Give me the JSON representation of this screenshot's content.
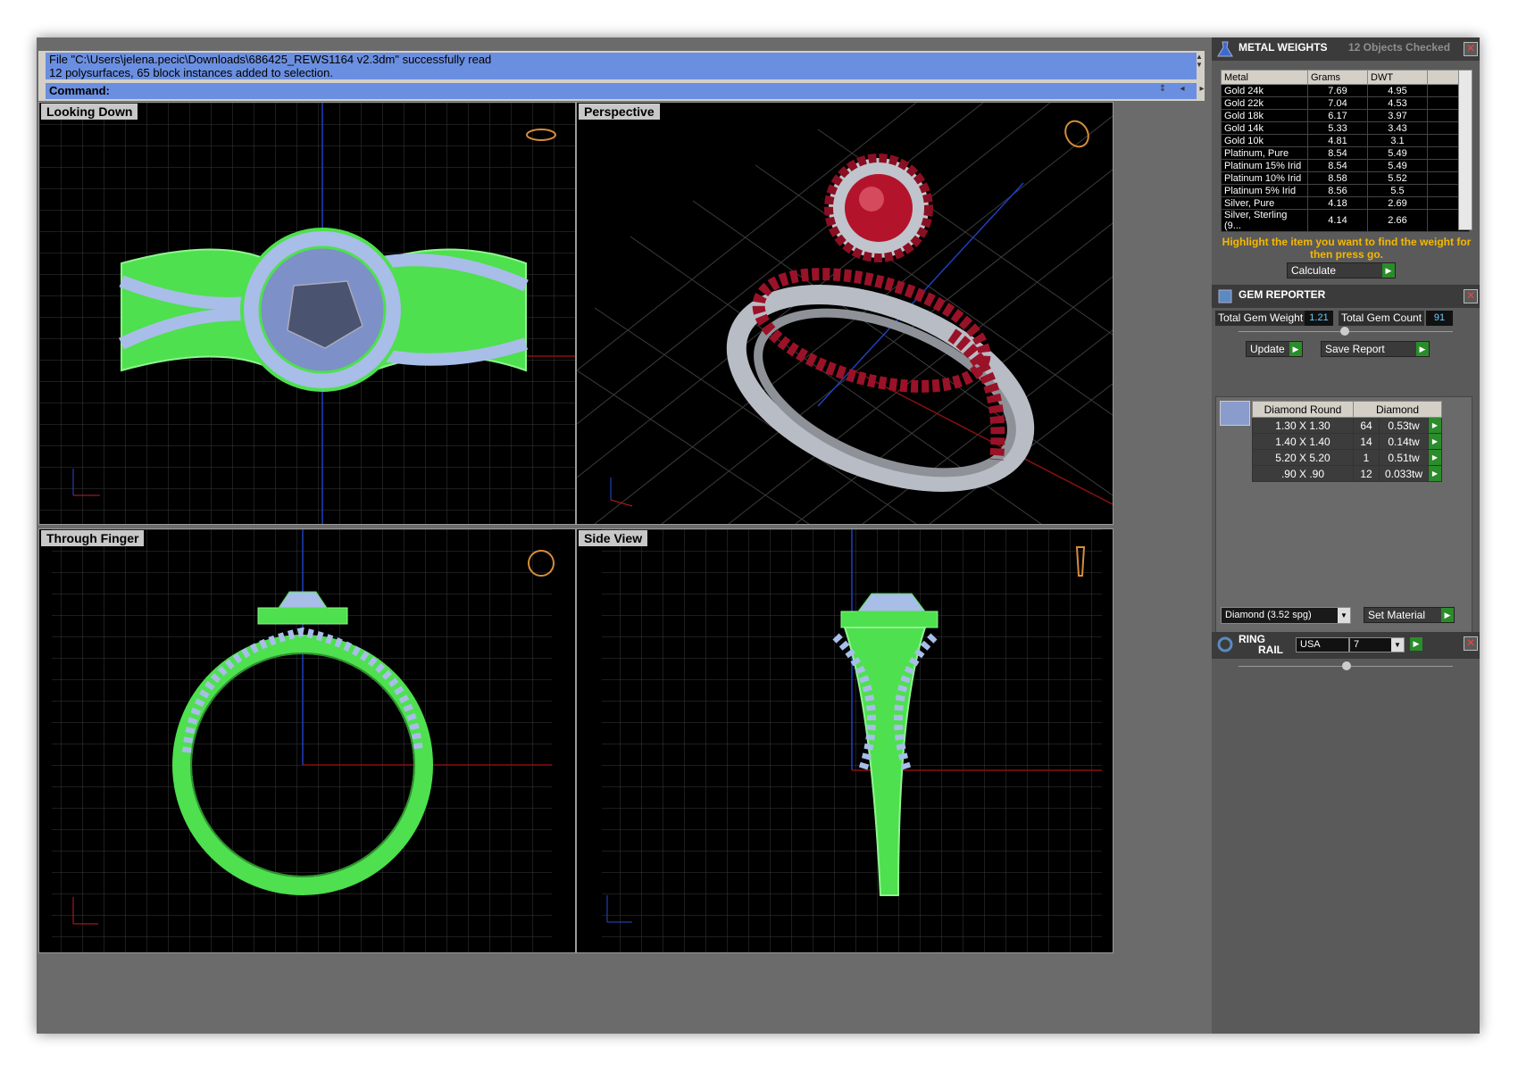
{
  "command": {
    "log_line1": "File \"C:\\Users\\jelena.pecic\\Downloads\\686425_REWS1164 v2.3dm\" successfully read",
    "log_line2": "12 polysurfaces, 65 block instances added to selection.",
    "prompt": "Command:"
  },
  "viewports": {
    "top_left": "Looking Down",
    "top_right": "Perspective",
    "bottom_left": "Through Finger",
    "bottom_right": "Side View"
  },
  "metal_weights": {
    "title": "METAL WEIGHTS",
    "status": "12 Objects Checked",
    "columns": [
      "Metal",
      "Grams",
      "DWT"
    ],
    "rows": [
      [
        "Gold 24k",
        "7.69",
        "4.95"
      ],
      [
        "Gold 22k",
        "7.04",
        "4.53"
      ],
      [
        "Gold 18k",
        "6.17",
        "3.97"
      ],
      [
        "Gold 14k",
        "5.33",
        "3.43"
      ],
      [
        "Gold 10k",
        "4.81",
        "3.1"
      ],
      [
        "Platinum, Pure",
        "8.54",
        "5.49"
      ],
      [
        "Platinum 15% Irid",
        "8.54",
        "5.49"
      ],
      [
        "Platinum 10% Irid",
        "8.58",
        "5.52"
      ],
      [
        "Platinum 5% Irid",
        "8.56",
        "5.5"
      ],
      [
        "Silver, Pure",
        "4.18",
        "2.69"
      ],
      [
        "Silver, Sterling (9...",
        "4.14",
        "2.66"
      ]
    ],
    "hint": "Highlight the item you want to find the weight for then press go.",
    "calculate": "Calculate"
  },
  "gem_reporter": {
    "title": "GEM REPORTER",
    "total_weight_label": "Total Gem Weight",
    "total_weight_value": "1.21",
    "total_count_label": "Total Gem Count",
    "total_count_value": "91",
    "update": "Update",
    "save_report": "Save Report",
    "gem_header_shape": "Diamond Round",
    "gem_header_material": "Diamond",
    "gems": [
      [
        "1.30 X 1.30",
        "64",
        "0.53tw"
      ],
      [
        "1.40 X 1.40",
        "14",
        "0.14tw"
      ],
      [
        "5.20 X 5.20",
        "1",
        "0.51tw"
      ],
      [
        ".90 X .90",
        "12",
        "0.033tw"
      ]
    ],
    "material_select": "Diamond    (3.52 spg)",
    "set_material": "Set Material"
  },
  "ring_rail": {
    "title_line1": "RING",
    "title_line2": "RAIL",
    "region": "USA",
    "size": "7"
  }
}
